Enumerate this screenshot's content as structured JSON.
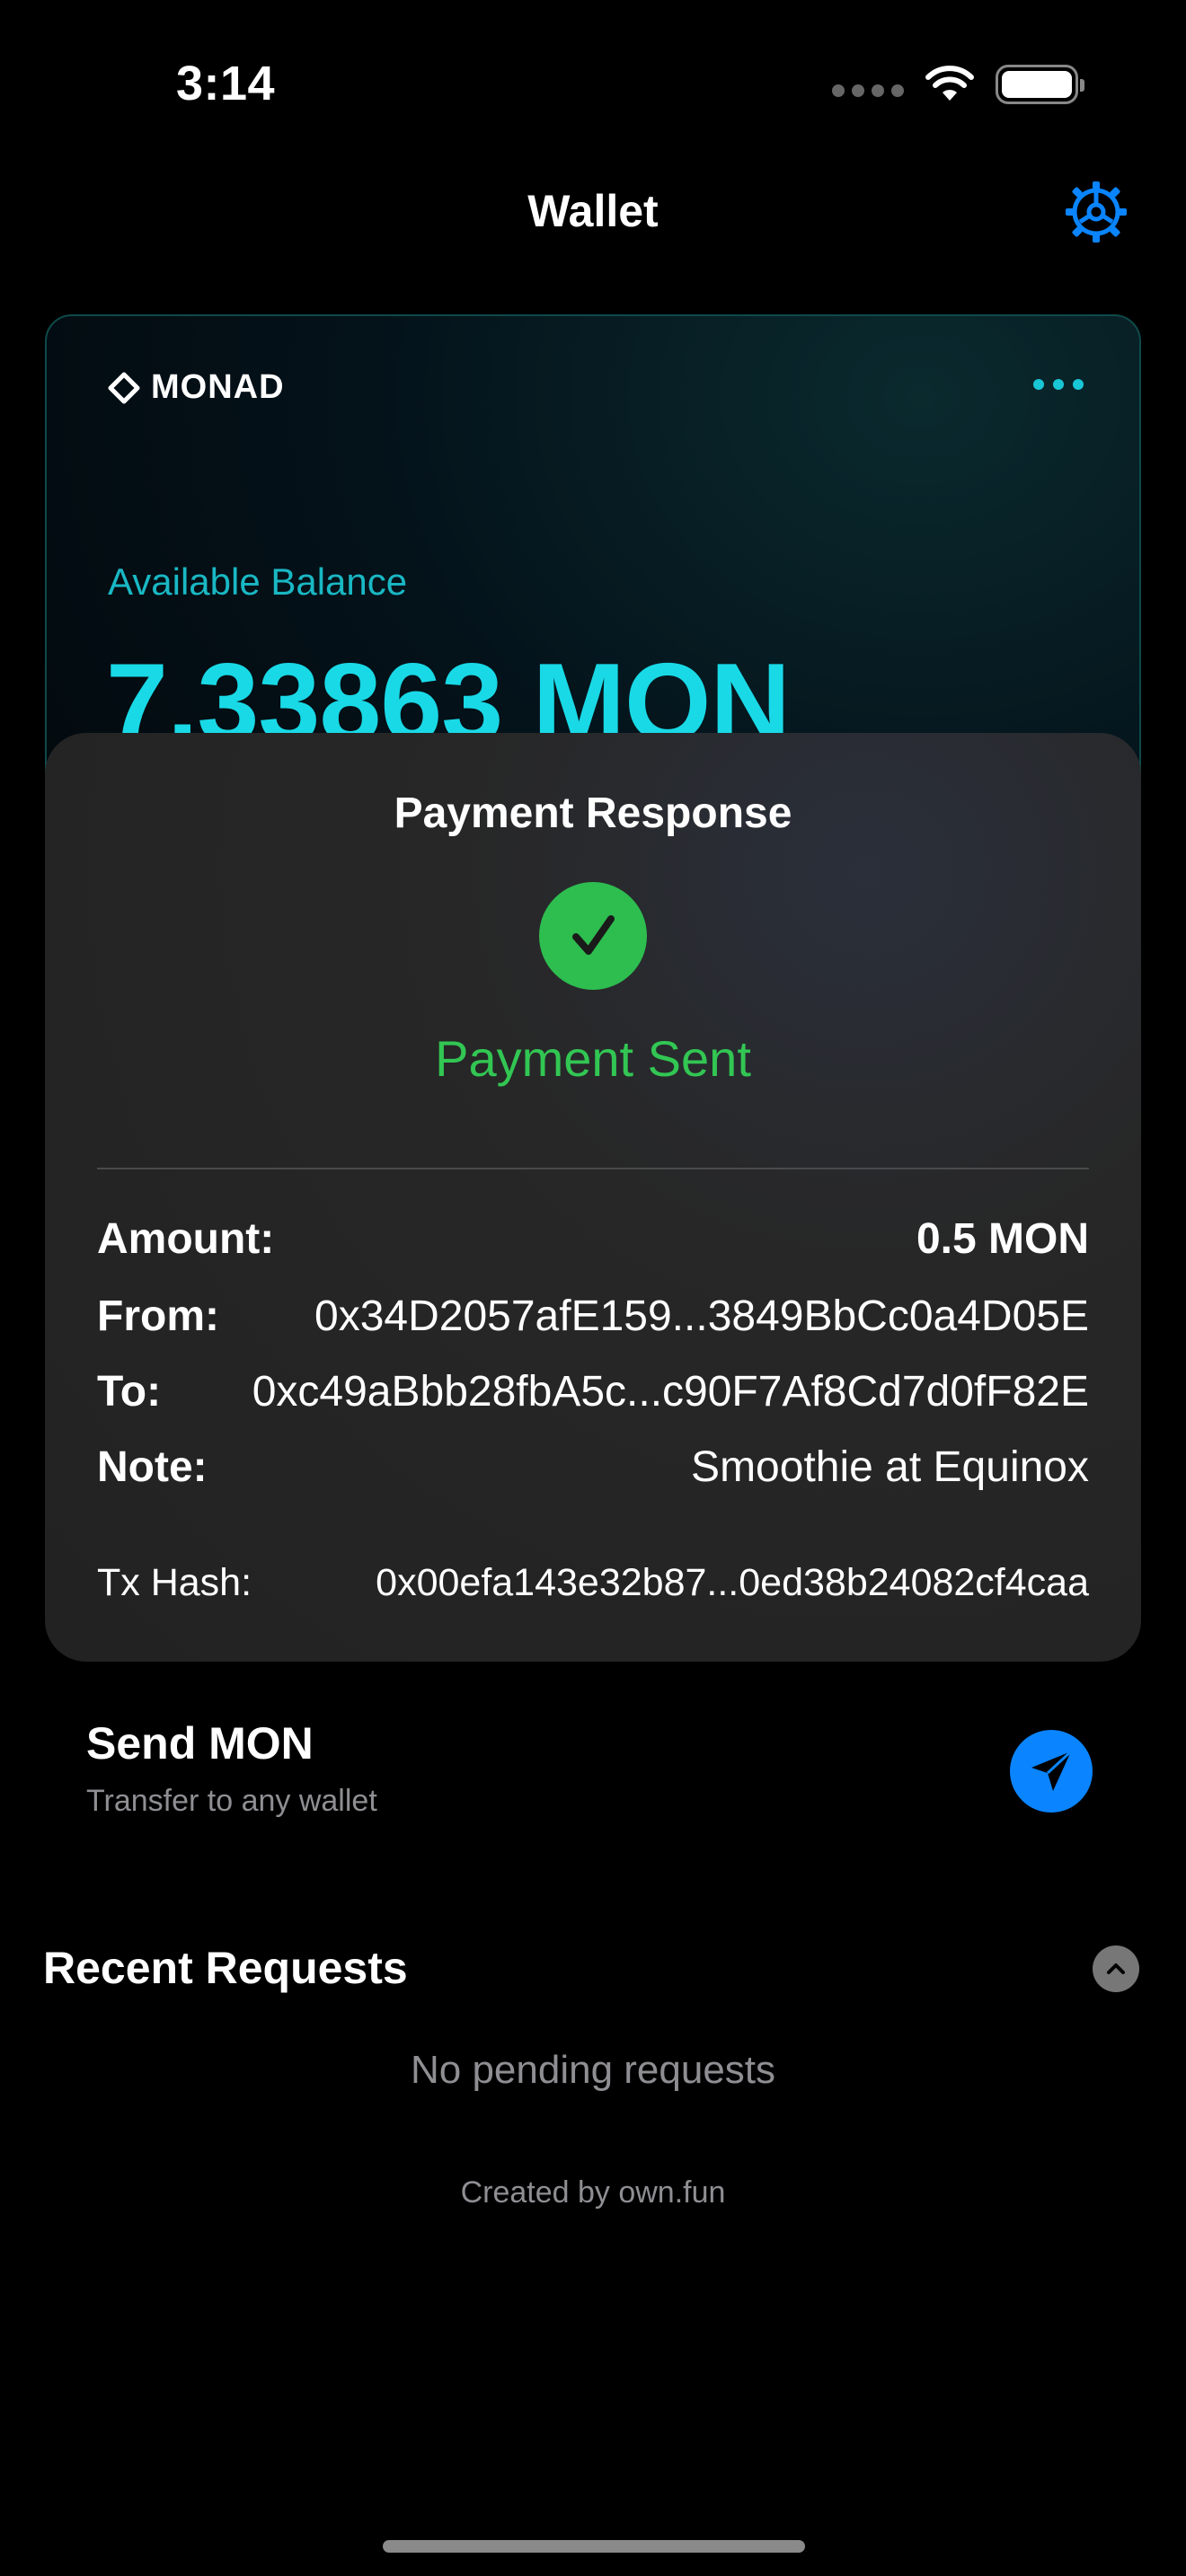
{
  "status_bar": {
    "time": "3:14"
  },
  "nav": {
    "title": "Wallet",
    "settings_icon": "gear-icon"
  },
  "card": {
    "brand": "MONAD",
    "balance_label": "Available Balance",
    "balance_value": "7.33863 MON"
  },
  "payment_response": {
    "title": "Payment Response",
    "status": "Payment Sent",
    "rows": {
      "amount": {
        "label": "Amount:",
        "value": "0.5 MON"
      },
      "from": {
        "label": "From:",
        "value": "0x34D2057afE159...3849BbCc0a4D05E"
      },
      "to": {
        "label": "To:",
        "value": "0xc49aBbb28fbA5c...c90F7Af8Cd7d0fF82E"
      },
      "note": {
        "label": "Note:",
        "value": "Smoothie at Equinox"
      },
      "tx_hash": {
        "label": "Tx Hash:",
        "value": "0x00efa143e32b87...0ed38b24082cf4caa"
      }
    }
  },
  "send": {
    "title": "Send MON",
    "subtitle": "Transfer to any wallet",
    "icon": "paper-plane-icon"
  },
  "recent_requests": {
    "title": "Recent Requests",
    "empty_text": "No pending requests"
  },
  "footer": {
    "credit": "Created by own.fun"
  },
  "colors": {
    "accent_cyan": "#19d9e6",
    "success_green": "#32c653",
    "ios_blue": "#0a84ff"
  }
}
